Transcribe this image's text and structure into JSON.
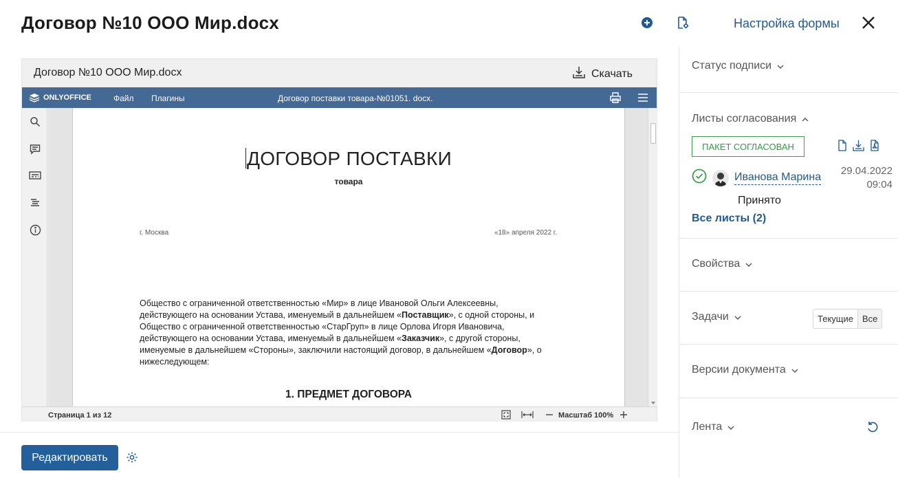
{
  "header": {
    "title": "Договор №10 ООО Мир.docx",
    "form_settings": "Настройка формы"
  },
  "viewer": {
    "filename": "Договор №10 ООО Мир.docx",
    "download": "Скачать",
    "editor": {
      "logo_text": "ONLYOFFICE",
      "menu_file": "Файл",
      "menu_plugins": "Плагины",
      "doc_title": "Договор поставки товара-№01051. docx.",
      "page_count": "Страница 1 из 12",
      "zoom": "Масштаб 100%"
    },
    "document": {
      "heading": "ДОГОВОР ПОСТАВКИ",
      "subheading": "товара",
      "city": "г. Москва",
      "date": "«18» апреля 2022 г.",
      "para_1": "Общество с ограниченной ответственностью «Мир» в лице Ивановой Ольги Алексеевны, действующего на основании Устава, именуемый в дальнейшем «",
      "para_b1": "Поставщик",
      "para_2": "», с одной стороны, и Общество с ограниченной ответственностью «СтарГруп» в лице Орлова Игоря Ивановича, действующего на основании Устава, именуемый в дальнейшем «",
      "para_b2": "Заказчик",
      "para_3": "», с другой стороны, именуемые в дальнейшем «Стороны», заключили настоящий договор, в дальнейшем «",
      "para_b3": "Договор",
      "para_4": "», о нижеследующем:",
      "section_1": "1. ПРЕДМЕТ ДОГОВОРА"
    }
  },
  "actions": {
    "edit_label": "Редактировать"
  },
  "panel": {
    "signature_status": "Статус подписи",
    "approval_sheets": "Листы согласования",
    "package_status": "ПАКЕТ СОГЛАСОВАН",
    "approver_name": "Иванова Марина",
    "approver_date": "29.04.2022",
    "approver_time": "09:04",
    "approver_status": "Принято",
    "all_sheets": "Все листы (2)",
    "properties": "Свойства",
    "tasks": "Задачи",
    "tasks_current": "Текущие",
    "tasks_all": "Все",
    "versions": "Версии документа",
    "feed": "Лента"
  },
  "colors": {
    "accent": "#1f5a93",
    "editor_bar": "#446995",
    "success": "#3aa14a"
  }
}
